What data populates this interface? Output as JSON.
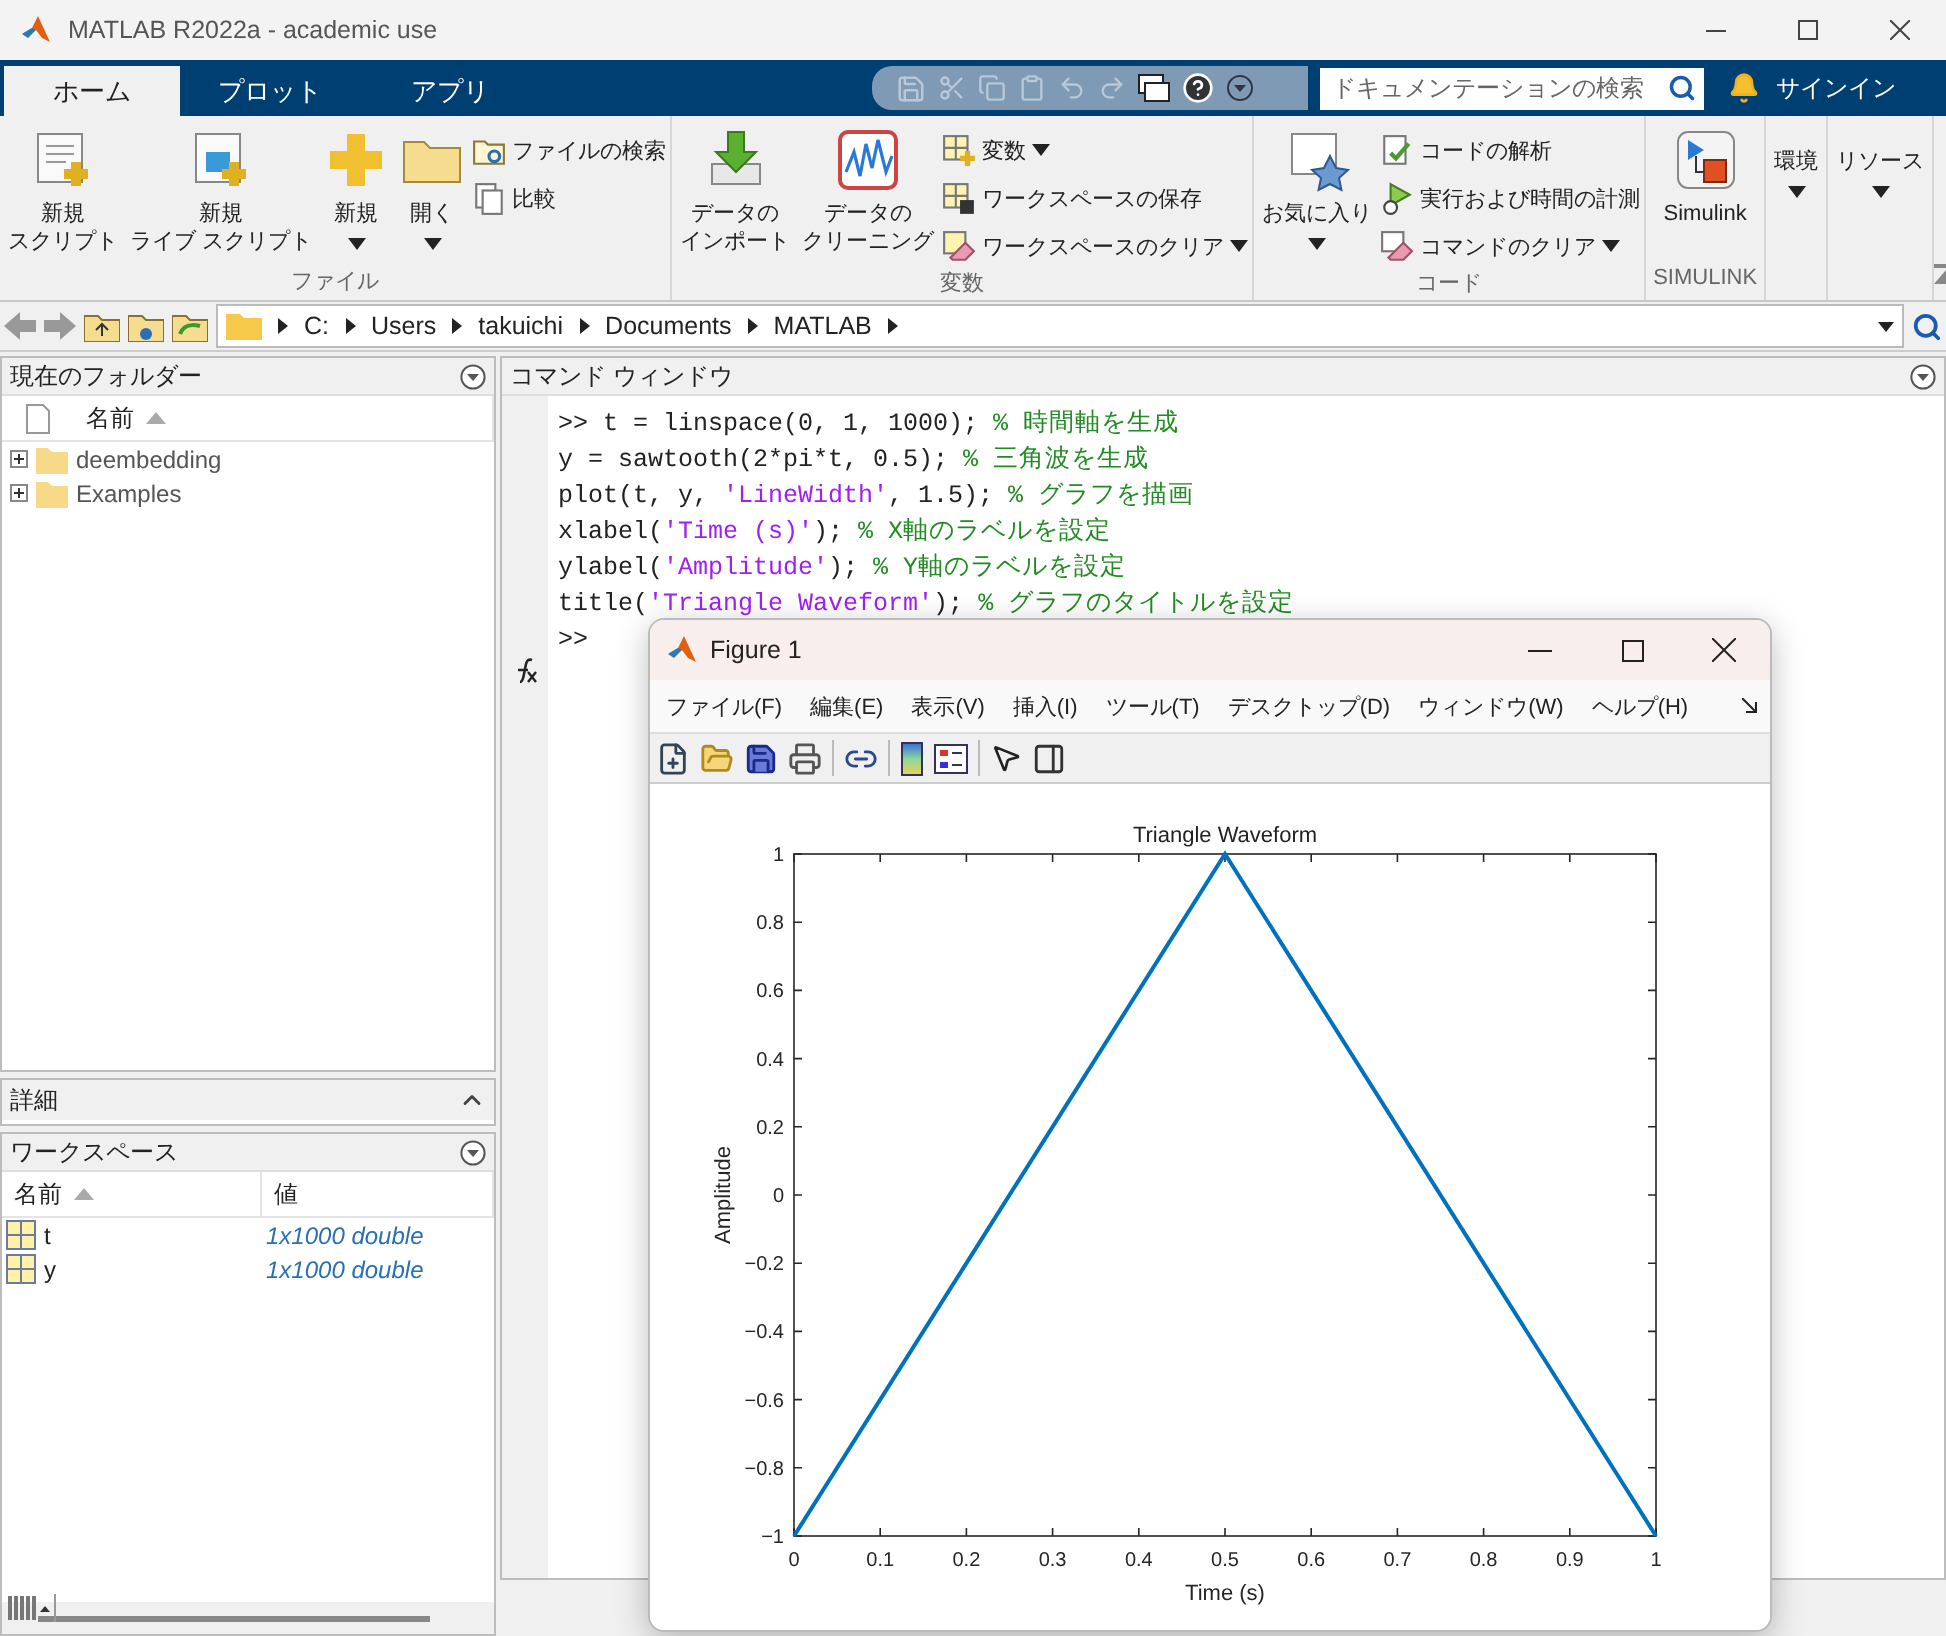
{
  "window": {
    "title": "MATLAB R2022a - academic use"
  },
  "tabs": [
    {
      "label": "ホーム",
      "selected": true
    },
    {
      "label": "プロット",
      "selected": false
    },
    {
      "label": "アプリ",
      "selected": false
    }
  ],
  "doc_search": {
    "placeholder": "ドキュメンテーションの検索"
  },
  "sign_in": "サインイン",
  "ribbon": [
    {
      "title": "ファイル",
      "items": [
        {
          "kind": "large",
          "lines": [
            "新規",
            "スクリプト"
          ],
          "menu": false
        },
        {
          "kind": "large",
          "lines": [
            "新規",
            "ライブ スクリプト"
          ],
          "menu": false
        },
        {
          "kind": "large",
          "lines": [
            "新規"
          ],
          "menu": true
        },
        {
          "kind": "large",
          "lines": [
            "開く"
          ],
          "menu": true
        },
        {
          "kind": "stack",
          "items": [
            {
              "label": "ファイルの検索",
              "menu": false
            },
            {
              "label": "比較",
              "menu": false
            }
          ]
        }
      ]
    },
    {
      "title": "変数",
      "items": [
        {
          "kind": "large",
          "lines": [
            "データの",
            "インポート"
          ],
          "menu": false
        },
        {
          "kind": "large",
          "lines": [
            "データの",
            "クリーニング"
          ],
          "menu": false
        },
        {
          "kind": "stack",
          "items": [
            {
              "label": "変数",
              "menu": true
            },
            {
              "label": "ワークスペースの保存",
              "menu": false
            },
            {
              "label": "ワークスペースのクリア",
              "menu": true
            }
          ]
        }
      ]
    },
    {
      "title": "コード",
      "items": [
        {
          "kind": "large",
          "lines": [
            "お気に入り"
          ],
          "menu": true
        },
        {
          "kind": "stack",
          "items": [
            {
              "label": "コードの解析",
              "menu": false
            },
            {
              "label": "実行および時間の計測",
              "menu": false
            },
            {
              "label": "コマンドのクリア",
              "menu": true
            }
          ]
        }
      ]
    },
    {
      "title": "SIMULINK",
      "items": [
        {
          "kind": "large",
          "lines": [
            "Simulink"
          ],
          "menu": false
        }
      ]
    },
    {
      "items": [
        {
          "kind": "text",
          "lines": [
            "環境"
          ],
          "menu": true
        }
      ]
    },
    {
      "items": [
        {
          "kind": "text",
          "lines": [
            "リソース"
          ],
          "menu": true
        }
      ]
    }
  ],
  "address": [
    "C:",
    "Users",
    "takuichi",
    "Documents",
    "MATLAB"
  ],
  "current_folder": {
    "title": "現在のフォルダー",
    "column": "名前",
    "items": [
      {
        "name": "deembedding",
        "expanded": false
      },
      {
        "name": "Examples",
        "expanded": false
      }
    ]
  },
  "details": {
    "title": "詳細"
  },
  "workspace": {
    "title": "ワークスペース",
    "columns": [
      "名前",
      "値"
    ],
    "rows": [
      {
        "name": "t",
        "value": "1x1000 double"
      },
      {
        "name": "y",
        "value": "1x1000 double"
      }
    ]
  },
  "command_window": {
    "title": "コマンド ウィンドウ",
    "lines": [
      [
        {
          "kind": "code",
          "text": ">> t = linspace(0, 1, 1000); "
        },
        {
          "kind": "comment",
          "text": "% 時間軸を生成"
        }
      ],
      [
        {
          "kind": "code",
          "text": "y = sawtooth(2*pi*t, 0.5); "
        },
        {
          "kind": "comment",
          "text": "% 三角波を生成"
        }
      ],
      [
        {
          "kind": "code",
          "text": "plot(t, y, "
        },
        {
          "kind": "string",
          "text": "'LineWidth'"
        },
        {
          "kind": "code",
          "text": ", 1.5); "
        },
        {
          "kind": "comment",
          "text": "% グラフを描画"
        }
      ],
      [
        {
          "kind": "code",
          "text": "xlabel("
        },
        {
          "kind": "string",
          "text": "'Time (s)'"
        },
        {
          "kind": "code",
          "text": "); "
        },
        {
          "kind": "comment",
          "text": "% X軸のラベルを設定"
        }
      ],
      [
        {
          "kind": "code",
          "text": "ylabel("
        },
        {
          "kind": "string",
          "text": "'Amplitude'"
        },
        {
          "kind": "code",
          "text": "); "
        },
        {
          "kind": "comment",
          "text": "% Y軸のラベルを設定"
        }
      ],
      [
        {
          "kind": "code",
          "text": "title("
        },
        {
          "kind": "string",
          "text": "'Triangle Waveform'"
        },
        {
          "kind": "code",
          "text": "); "
        },
        {
          "kind": "comment",
          "text": "% グラフのタイトルを設定"
        }
      ]
    ],
    "prompt": ">>"
  },
  "figure": {
    "title": "Figure 1",
    "menu": [
      "ファイル(F)",
      "編集(E)",
      "表示(V)",
      "挿入(I)",
      "ツール(T)",
      "デスクトップ(D)",
      "ウィンドウ(W)",
      "ヘルプ(H)"
    ],
    "chart_data": {
      "type": "line",
      "title": "Triangle Waveform",
      "xlabel": "Time (s)",
      "ylabel": "Amplitude",
      "x": [
        0,
        0.5,
        1
      ],
      "series": [
        {
          "values": [
            -1,
            1,
            -1
          ]
        }
      ],
      "xlim": [
        0,
        1
      ],
      "ylim": [
        -1,
        1
      ],
      "xticks": [
        0,
        0.1,
        0.2,
        0.3,
        0.4,
        0.5,
        0.6,
        0.7,
        0.8,
        0.9,
        1
      ],
      "yticks": [
        -1,
        -0.8,
        -0.6,
        -0.4,
        -0.2,
        0,
        0.2,
        0.4,
        0.6,
        0.8,
        1
      ]
    }
  }
}
